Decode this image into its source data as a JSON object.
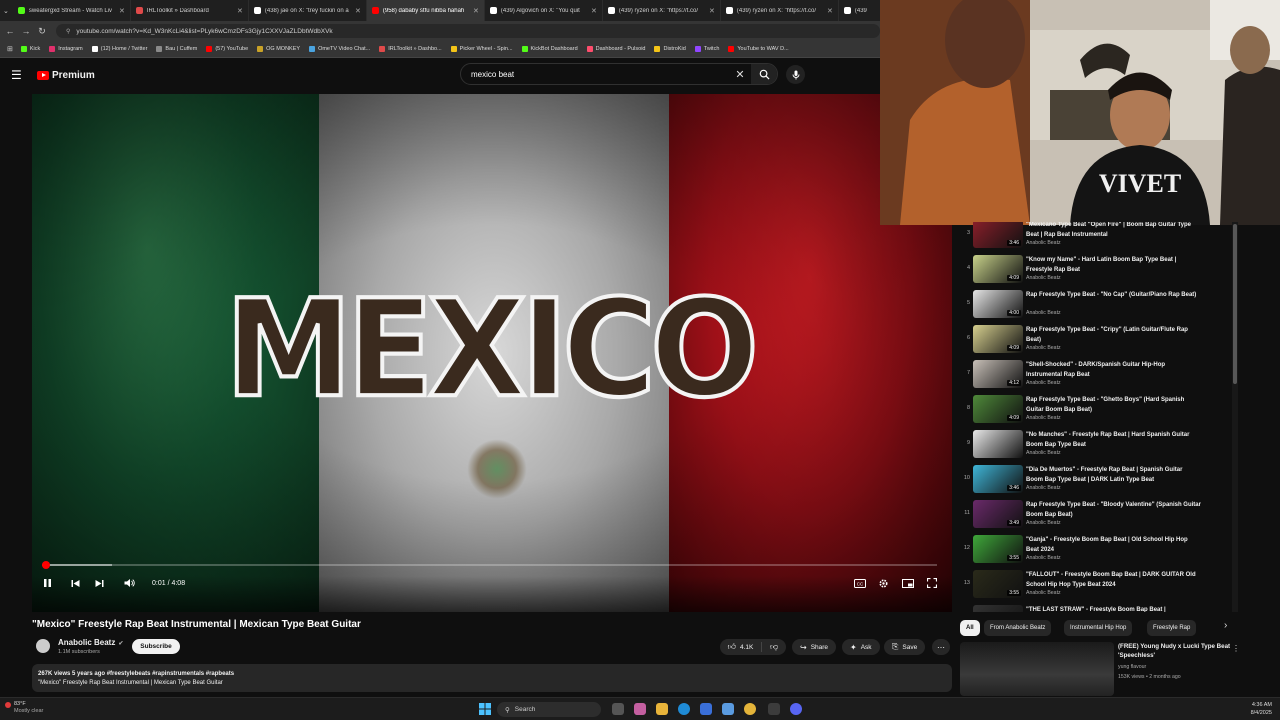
{
  "browser": {
    "tabs": [
      {
        "label": "sweatergxd Stream - Watch Liv",
        "color": "#53fc18",
        "active": false
      },
      {
        "label": "IRLToolkit » Dashboard",
        "color": "#e04a4a",
        "active": false
      },
      {
        "label": "(438) jae on X: \"trey fuckin on a",
        "color": "#ffffff",
        "active": false
      },
      {
        "label": "(958) dababy stfu nibba hahah",
        "color": "#ff0000",
        "active": true
      },
      {
        "label": "(439) Algovich on X: \"You quit",
        "color": "#ffffff",
        "active": false
      },
      {
        "label": "(439) ryzen on X: \"https://t.co/",
        "color": "#ffffff",
        "active": false
      },
      {
        "label": "(439) ryzen on X: \"https://t.co/",
        "color": "#ffffff",
        "active": false
      },
      {
        "label": "(439",
        "color": "#ffffff",
        "active": false
      }
    ],
    "url": "youtube.com/watch?v=Kd_W3nKcLi4&list=PLyk6wCmzDFs3Gjy1CXXVJaZLDbtWdbXVk",
    "bookmarks": [
      {
        "label": "Kick",
        "color": "#53fc18"
      },
      {
        "label": "Instagram",
        "color": "#e1306c"
      },
      {
        "label": "(12) Home / Twitter",
        "color": "#ffffff"
      },
      {
        "label": "Bau | Cuffem",
        "color": "#8a8a8a"
      },
      {
        "label": "(57) YouTube",
        "color": "#ff0000"
      },
      {
        "label": "OG MONKEY",
        "color": "#c9a227"
      },
      {
        "label": "OmeTV Video Chat...",
        "color": "#4aa3df"
      },
      {
        "label": "IRLToolkit » Dashbo...",
        "color": "#e04a4a"
      },
      {
        "label": "Picker Wheel - Spin...",
        "color": "#f5c518"
      },
      {
        "label": "KickBot Dashboard",
        "color": "#53fc18"
      },
      {
        "label": "Dashboard - Pulsoid",
        "color": "#ff4d6d"
      },
      {
        "label": "DistroKid",
        "color": "#f5c518"
      },
      {
        "label": "Twitch",
        "color": "#9146ff"
      },
      {
        "label": "YouTube to WAV D...",
        "color": "#ff0000"
      }
    ]
  },
  "youtube": {
    "logo": "Premium",
    "search_query": "mexico beat",
    "player": {
      "overlay_text": "MEXICO",
      "time": "0:01 / 4:08",
      "progress_fraction": 0.004
    },
    "video_title": "\"Mexico\" Freestyle Rap Beat Instrumental | Mexican Type Beat Guitar",
    "channel": {
      "name": "Anabolic Beatz",
      "subs": "1.1M subscribers",
      "subscribe": "Subscribe"
    },
    "actions": {
      "likes": "4.1K",
      "share": "Share",
      "ask": "Ask",
      "save": "Save"
    },
    "description": {
      "meta": "267K views  5 years ago  #freestylebeats #rapinstrumentals #rapbeats",
      "text": "\"Mexico\" Freestyle Rap Beat Instrumental | Mexican Type Beat Guitar"
    },
    "playlist": [
      {
        "num": "3",
        "title": "\"Mexicano Type Beat \"Open Fire\" | Boom Bap Guitar Type Beat | Rap Beat Instrumental",
        "channel": "Anabolic Beatz",
        "duration": "3:46",
        "color": "#8a1f2a"
      },
      {
        "num": "4",
        "title": "\"Know my Name\" - Hard Latin Boom Bap Type Beat | Freestyle Rap Beat",
        "channel": "Anabolic Beatz",
        "duration": "4:09",
        "color": "#c8d28a"
      },
      {
        "num": "5",
        "title": "Rap Freestyle Type Beat - \"No Cap\" (Guitar/Piano Rap Beat)",
        "channel": "Anabolic Beatz",
        "duration": "4:00",
        "color": "#e6e6e6"
      },
      {
        "num": "6",
        "title": "Rap Freestyle Type Beat - \"Cripy\" (Latin Guitar/Flute Rap Beat)",
        "channel": "Anabolic Beatz",
        "duration": "4:09",
        "color": "#d7d08f"
      },
      {
        "num": "7",
        "title": "\"Shell-Shocked\" - DARK/Spanish Guitar Hip-Hop Instrumental Rap Beat",
        "channel": "Anabolic Beatz",
        "duration": "4:12",
        "color": "#c8c0b8"
      },
      {
        "num": "8",
        "title": "Rap Freestyle Type Beat - \"Ghetto Boys\" (Hard Spanish Guitar Boom Bap Beat)",
        "channel": "Anabolic Beatz",
        "duration": "4:09",
        "color": "#4f8a3a"
      },
      {
        "num": "9",
        "title": "\"No Manches\" - Freestyle Rap Beat | Hard Spanish Guitar Boom Bap Type Beat",
        "channel": "Anabolic Beatz",
        "duration": "",
        "color": "#e9e9e9"
      },
      {
        "num": "10",
        "title": "\"Dia De Muertos\" - Freestyle Rap Beat | Spanish Guitar Boom Bap Type Beat | DARK Latin Type Beat",
        "channel": "Anabolic Beatz",
        "duration": "3:46",
        "color": "#3fb6d8"
      },
      {
        "num": "11",
        "title": "Rap Freestyle Type Beat - \"Bloody Valentine\" (Spanish Guitar Boom Bap Beat)",
        "channel": "Anabolic Beatz",
        "duration": "3:49",
        "color": "#6a2a6a"
      },
      {
        "num": "12",
        "title": "\"Ganja\" - Freestyle Boom Bap Beat | Old School Hip Hop Beat 2024",
        "channel": "Anabolic Beatz",
        "duration": "3:55",
        "color": "#3fa83a"
      },
      {
        "num": "13",
        "title": "\"FALLOUT\" - Freestyle Boom Bap Beat | DARK GUITAR Old School Hip Hop Type Beat 2024",
        "channel": "Anabolic Beatz",
        "duration": "3:55",
        "color": "#2a2a1a"
      },
      {
        "num": "",
        "title": "\"THE LAST STRAW\" - Freestyle Boom Bap Beat |",
        "channel": "",
        "duration": "",
        "color": "#333333"
      }
    ],
    "chips": [
      "All",
      "From Anabolic Beatz",
      "Instrumental Hip Hop",
      "Freestyle Rap"
    ],
    "recommendation": {
      "title": "(FREE) Young Nudy x Lucki Type Beat 'Speechless'",
      "channel": "yung flavour",
      "meta": "153K views • 2 months ago"
    }
  },
  "webcam": {
    "shirt_text": "VIVET"
  },
  "taskbar": {
    "weather_temp": "83°F",
    "weather_desc": "Mostly clear",
    "search": "Search",
    "time": "4:36 AM",
    "date": "8/4/2025"
  }
}
